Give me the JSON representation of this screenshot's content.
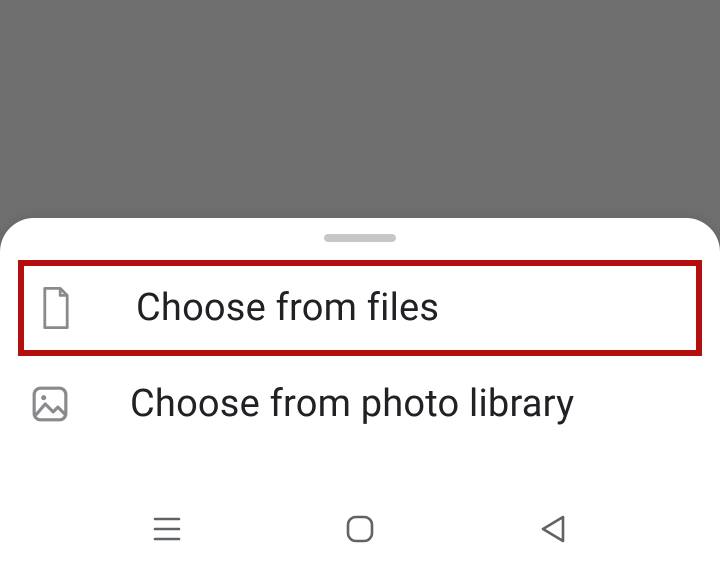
{
  "sheet": {
    "items": [
      {
        "label": "Choose from files",
        "highlighted": true
      },
      {
        "label": "Choose from photo library",
        "highlighted": false
      }
    ]
  },
  "colors": {
    "highlight": "#b40f0f",
    "background_dim": "#6f6f6f",
    "sheet_bg": "#ffffff",
    "icon": "#8a8a8e"
  }
}
